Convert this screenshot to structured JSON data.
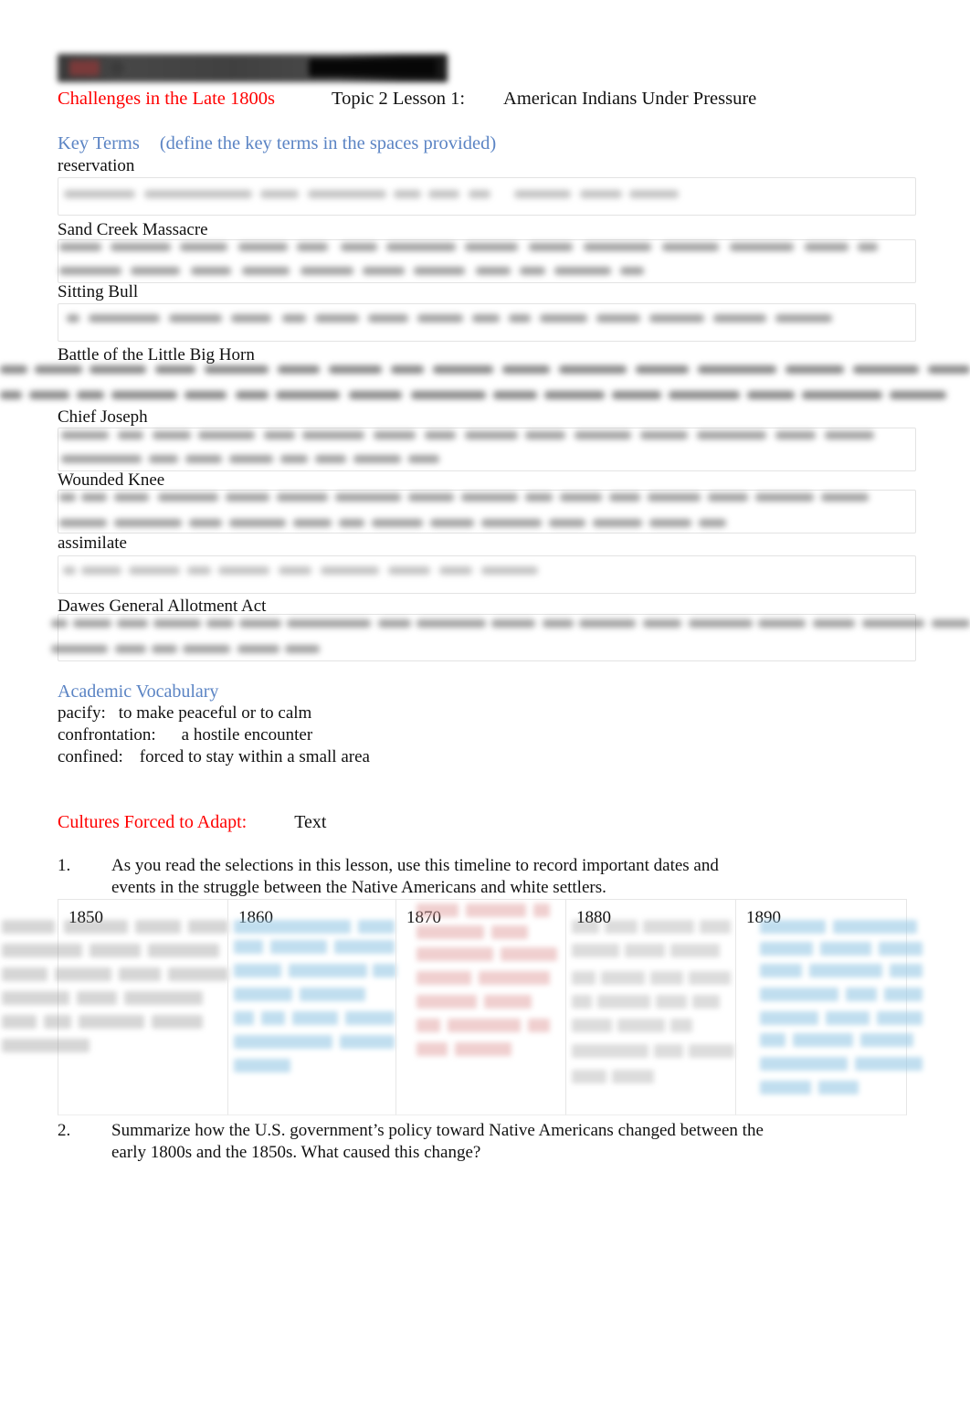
{
  "document": {
    "header_bar": {
      "redacted": true,
      "description": "redacted-black-header-bar"
    },
    "title": {
      "red_part": "Challenges in the Late 1800s",
      "topic": "Topic 2 Lesson 1:",
      "lesson_title": "American Indians Under Pressure"
    },
    "key_terms_section": {
      "heading": "Key Terms",
      "instruction": "(define the key terms in the spaces provided)",
      "heading_color": "#5b84c4",
      "terms": [
        {
          "label": "reservation",
          "answer_redacted": true
        },
        {
          "label": "Sand Creek Massacre",
          "answer_redacted": true
        },
        {
          "label": "Sitting Bull",
          "answer_redacted": true
        },
        {
          "label": "Battle of the Little Big Horn",
          "answer_redacted": true
        },
        {
          "label": "Chief Joseph",
          "answer_redacted": true
        },
        {
          "label": "Wounded Knee",
          "answer_redacted": true
        },
        {
          "label": "assimilate",
          "answer_redacted": true
        },
        {
          "label": "Dawes General Allotment Act",
          "answer_redacted": true
        }
      ]
    },
    "academic_vocabulary": {
      "heading": "Academic Vocabulary",
      "heading_color": "#5b84c4",
      "entries": [
        {
          "term": "pacify:",
          "definition": "to make peaceful or to calm"
        },
        {
          "term": "confrontation:",
          "definition": "a hostile encounter"
        },
        {
          "term": "confined:",
          "definition": "forced to stay within a small area"
        }
      ]
    },
    "cultures_section": {
      "heading": "Cultures Forced to Adapt:",
      "heading_color": "#ff0000",
      "source_label": "Text",
      "questions": [
        {
          "number": "1.",
          "line1": "As you read the selections in this lesson, use this timeline to record important dates and",
          "line2": "events in the struggle between the Native Americans and white settlers."
        },
        {
          "number": "2.",
          "line1": "Summarize   how the U.S. government’s policy toward Native Americans changed between the",
          "line2": "early 1800s and the 1850s. What caused this change?"
        }
      ]
    },
    "timeline": {
      "columns": [
        {
          "year": "1850",
          "answer_redacted": true,
          "highlight": "grey"
        },
        {
          "year": "1860",
          "answer_redacted": true,
          "highlight": "blue"
        },
        {
          "year": "1870",
          "answer_redacted": true,
          "highlight": "pink"
        },
        {
          "year": "1880",
          "answer_redacted": true,
          "highlight": "plain"
        },
        {
          "year": "1890",
          "answer_redacted": true,
          "highlight": "blue"
        }
      ]
    }
  }
}
